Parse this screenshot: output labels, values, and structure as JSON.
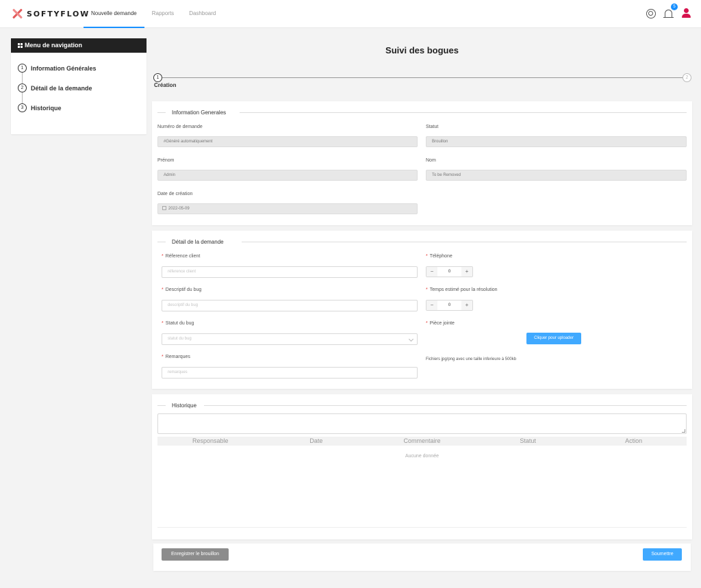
{
  "app": {
    "brand": "SOFTYFLOW"
  },
  "nav": {
    "items": [
      {
        "label": "Nouvelle demande",
        "active": true
      },
      {
        "label": "Rapports",
        "active": false
      },
      {
        "label": "Dashboard",
        "active": false
      }
    ],
    "notification_count": "5"
  },
  "sidebar": {
    "title": "Menu de navigation",
    "steps": [
      {
        "num": "1",
        "label": "Information Générales"
      },
      {
        "num": "2",
        "label": "Détail de la demande"
      },
      {
        "num": "3",
        "label": "Historique"
      }
    ]
  },
  "page": {
    "title": "Suivi des bogues"
  },
  "stepper": {
    "step1_num": "1",
    "step1_label": "Création",
    "step2_num": "2"
  },
  "info": {
    "legend": "Information Generales",
    "numero_label": "Numéro de demande",
    "numero_value": "#Généré automatiquement",
    "statut_label": "Statut",
    "statut_value": "Brouillon",
    "prenom_label": "Prénom",
    "prenom_value": "Admin",
    "nom_label": "Nom",
    "nom_value": "To be Removed",
    "date_label": "Date de création",
    "date_value": "2022-05-09"
  },
  "detail": {
    "legend": "Détail de la demande",
    "ref_label": "Réference client",
    "ref_placeholder": "réference client",
    "tel_label": "Téléphone",
    "tel_value": "0",
    "desc_label": "Descriptif du bug",
    "desc_placeholder": "descriptif du bug",
    "temps_label": "Temps estimé pour la résolution",
    "temps_value": "0",
    "statut_label": "Statut du bug",
    "statut_placeholder": "statut du bug",
    "piece_label": "Pièce jointe",
    "upload_button": "Cliquer pour uploader",
    "upload_note": "Fichiers jpg/png avec une taille inferieure à 500kb",
    "remarques_label": "Remarques",
    "remarques_placeholder": "remarques"
  },
  "historique": {
    "legend": "Historique",
    "columns": [
      "Responsable",
      "Date",
      "Commentaire",
      "Statut",
      "Action"
    ],
    "empty": "Aucune donnée"
  },
  "actions": {
    "draft": "Enregistrer le brouillon",
    "submit": "Soumettre"
  },
  "colors": {
    "accent": "#1890ff",
    "button_blue": "#40a9ff",
    "user_icon": "#d6144e",
    "required": "#e53935"
  }
}
